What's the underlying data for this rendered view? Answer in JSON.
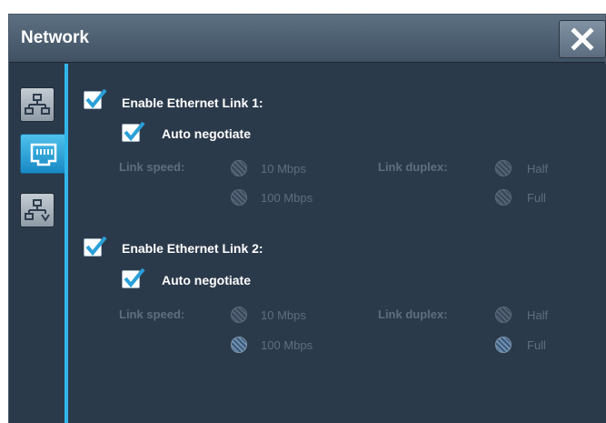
{
  "window": {
    "title": "Network"
  },
  "colors": {
    "accent": "#33b5ea",
    "panel": "#2b3a4b",
    "check": "#2a9fd8"
  },
  "sidebar": {
    "tabs": [
      {
        "icon": "network-topology-icon",
        "active": false
      },
      {
        "icon": "ethernet-port-icon",
        "active": true
      },
      {
        "icon": "network-tree-icon",
        "active": false
      }
    ]
  },
  "links": [
    {
      "enable_label": "Enable Ethernet Link 1:",
      "enabled": true,
      "auto_label": "Auto negotiate",
      "auto": true,
      "speed_label": "Link speed:",
      "speed_options": [
        "10 Mbps",
        "100 Mbps"
      ],
      "speed_selected": null,
      "duplex_label": "Link duplex:",
      "duplex_options": [
        "Half",
        "Full"
      ],
      "duplex_selected": null
    },
    {
      "enable_label": "Enable Ethernet Link 2:",
      "enabled": true,
      "auto_label": "Auto negotiate",
      "auto": true,
      "speed_label": "Link speed:",
      "speed_options": [
        "10 Mbps",
        "100 Mbps"
      ],
      "speed_selected": "100 Mbps",
      "duplex_label": "Link duplex:",
      "duplex_options": [
        "Half",
        "Full"
      ],
      "duplex_selected": "Full"
    }
  ]
}
